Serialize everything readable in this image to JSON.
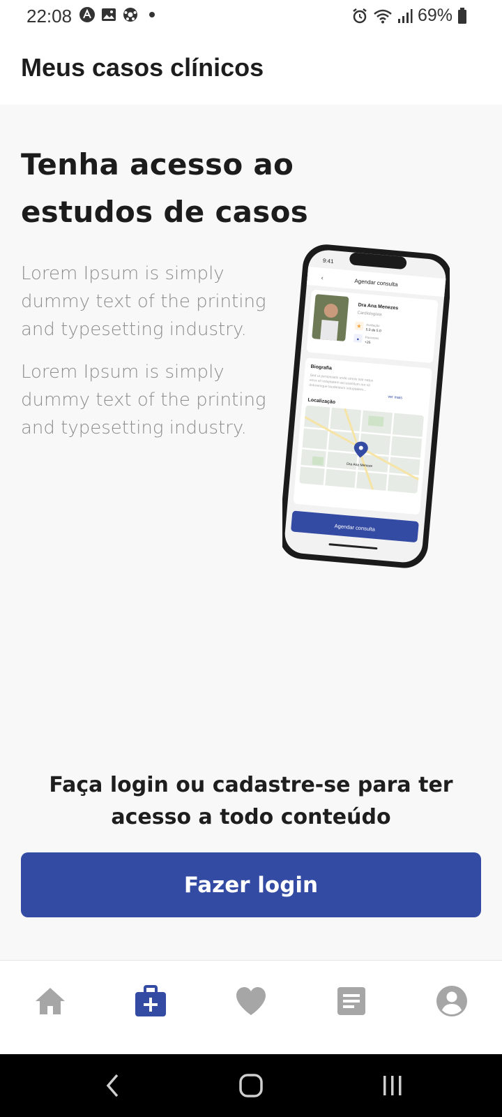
{
  "status_bar": {
    "time": "22:08",
    "battery": "69%",
    "left_icons": [
      "a-circle-icon",
      "image-icon",
      "soccer-ball-icon",
      "dot-icon"
    ],
    "right_icons": [
      "alarm-icon",
      "wifi-icon",
      "signal-icon",
      "battery-icon"
    ]
  },
  "app_bar": {
    "title": "Meus casos clínicos"
  },
  "main": {
    "headline": "Tenha acesso ao estudos de casos",
    "paragraphs": [
      "Lorem Ipsum is simply dummy text of the printing and typesetting industry.",
      "Lorem Ipsum is simply dummy text of the printing and typesetting industry."
    ],
    "phone_mockup": {
      "time": "9:41",
      "screen_title": "Agendar consulta",
      "doctor_name": "Dra Ana Menezes",
      "specialty": "Cardiologista",
      "rating_label": "Avaliação",
      "rating_value": "5.0 de 5.0",
      "patients_label": "Pacientes",
      "patients_value": "+25",
      "bio_title": "Biografia",
      "bio_text": "Sed ut perspiciatis unde omnis iste natus error sit voluptatem accusantium nor sit doloremque laudantium voluptatem...",
      "bio_more": "ver mais",
      "location_title": "Localização",
      "map_pin_label": "Dra Ana Meneze",
      "button_label": "Agendar consulta"
    },
    "cta_text": "Faça login ou cadastre-se para ter acesso a todo conteúdo",
    "login_button": "Fazer login"
  },
  "bottom_nav": {
    "items": [
      {
        "name": "home-icon",
        "active": false
      },
      {
        "name": "medical-case-icon",
        "active": true
      },
      {
        "name": "heart-icon",
        "active": false
      },
      {
        "name": "document-icon",
        "active": false
      },
      {
        "name": "profile-icon",
        "active": false
      }
    ]
  },
  "system_nav": [
    "back-icon",
    "home-circle-icon",
    "recents-icon"
  ],
  "colors": {
    "accent": "#344ba4",
    "nav_inactive": "#a6a6a6",
    "background": "#f8f8f8"
  }
}
